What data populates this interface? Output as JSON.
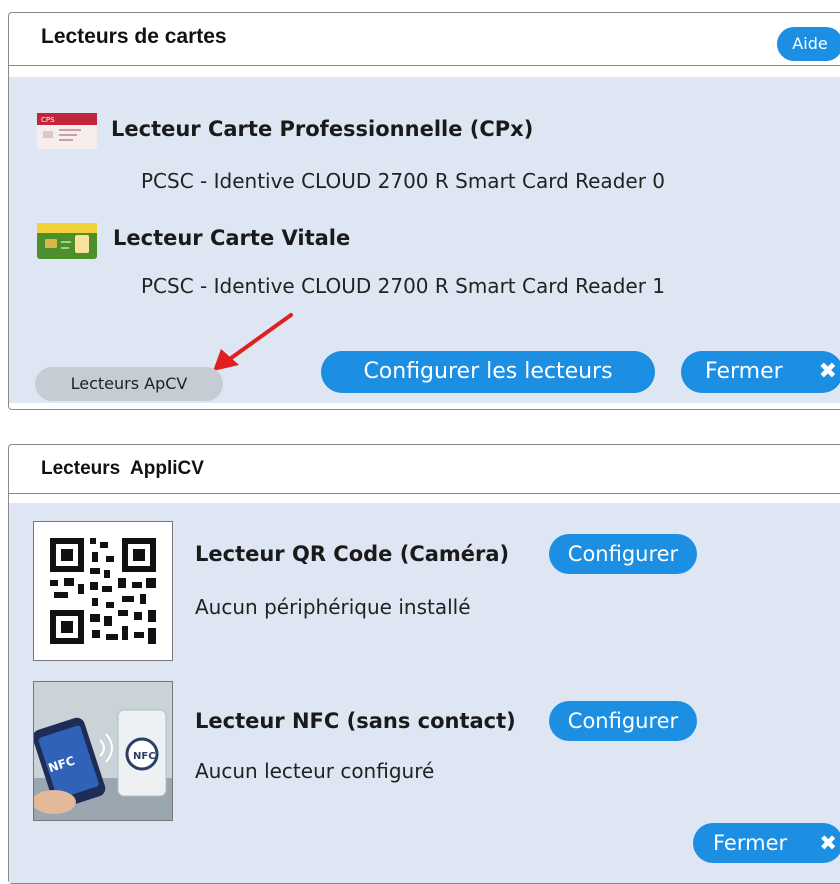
{
  "card_readers_panel": {
    "title": "Lecteurs de cartes",
    "help_label": "Aide",
    "cpx": {
      "title": "Lecteur Carte Professionnelle (CPx)",
      "device": "PCSC - Identive CLOUD 2700 R Smart Card Reader 0"
    },
    "vitale": {
      "title": "Lecteur Carte Vitale",
      "device": "PCSC - Identive CLOUD 2700 R Smart Card Reader 1"
    },
    "apcv_label": "Lecteurs ApCV",
    "configure_label": "Configurer les lecteurs",
    "close_label": "Fermer",
    "close_icon": "✖",
    "colors": {
      "accent": "#1d8fe3",
      "body_bg": "#dde6f2",
      "arrow": "#e02020"
    }
  },
  "applicv_panel": {
    "title": "Lecteurs  AppliCV",
    "qr": {
      "title": "Lecteur QR Code (Caméra)",
      "status": "Aucun périphérique installé",
      "configure_label": "Configurer"
    },
    "nfc": {
      "title": "Lecteur NFC (sans contact)",
      "status": "Aucun lecteur configuré",
      "configure_label": "Configurer",
      "badge_text": "NFC"
    },
    "close_label": "Fermer",
    "close_icon": "✖"
  }
}
